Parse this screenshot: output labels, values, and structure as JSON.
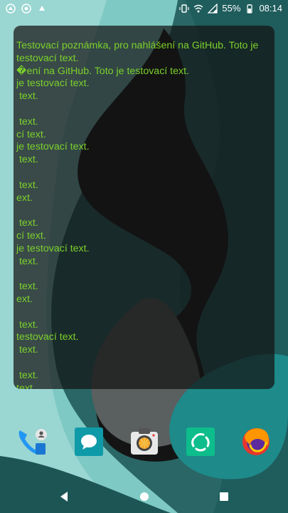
{
  "status_bar": {
    "battery": "55%",
    "time": "08:14",
    "icons": [
      "sim-icon",
      "record-icon",
      "notification-icon",
      "vibrate-icon",
      "wifi-icon",
      "signal-icon",
      "battery-icon"
    ]
  },
  "note_widget": {
    "lines": [
      "Testovací poznámka, pro nahlášení na GitHub. Toto je testovací text.",
      "�ení na GitHub. Toto je testovací text.",
      "je testovací text.",
      " text.",
      "",
      " text.",
      "cí text.",
      "je testovací text.",
      " text.",
      "",
      " text.",
      "ext.",
      "",
      " text.",
      "cí text.",
      "je testovací text.",
      " text.",
      "",
      " text.",
      "ext.",
      "",
      " text.",
      "testovací text.",
      " text.",
      "",
      " text.",
      "text."
    ],
    "color": "#7cd12b"
  },
  "dock": {
    "apps": [
      "phone-contacts-icon",
      "messages-icon",
      "camera-icon",
      "element-icon",
      "firefox-icon"
    ]
  },
  "nav_bar": {
    "buttons": [
      "back-icon",
      "home-icon",
      "recents-icon"
    ]
  }
}
